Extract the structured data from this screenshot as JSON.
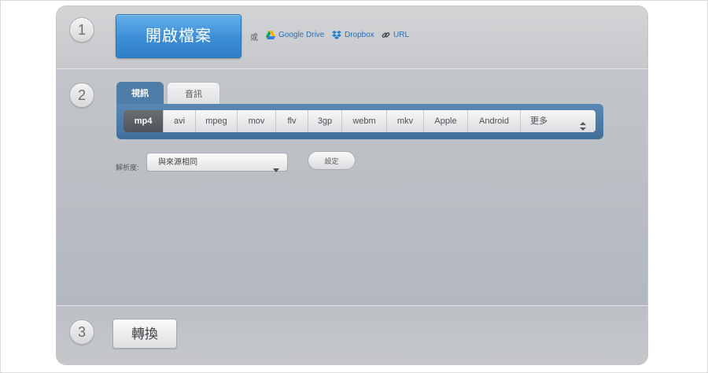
{
  "step1": {
    "number": "1",
    "open_button": "開啟檔案",
    "or_text": "或",
    "links": [
      {
        "label": "Google Drive",
        "icon": "google-drive-icon"
      },
      {
        "label": "Dropbox",
        "icon": "dropbox-icon"
      },
      {
        "label": "URL",
        "icon": "link-icon"
      }
    ]
  },
  "step2": {
    "number": "2",
    "tabs": [
      {
        "label": "視訊",
        "active": true
      },
      {
        "label": "音訊",
        "active": false
      }
    ],
    "formats": [
      "mp4",
      "avi",
      "mpeg",
      "mov",
      "flv",
      "3gp",
      "webm",
      "mkv",
      "Apple",
      "Android"
    ],
    "active_format": "mp4",
    "more_label": "更多",
    "resolution": {
      "label": "解析度:",
      "selected": "與來源相同"
    },
    "settings_button": "設定"
  },
  "step3": {
    "number": "3",
    "convert_button": "轉換"
  },
  "colors": {
    "primary_blue": "#3c8ed6",
    "tab_blue": "#4e7da8",
    "link_blue": "#2a6fb8"
  }
}
